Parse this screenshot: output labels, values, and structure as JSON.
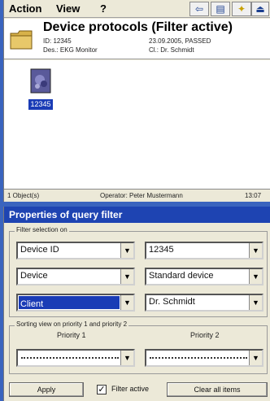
{
  "menubar": {
    "action": "Action",
    "view": "View",
    "help": "?"
  },
  "toolbar": {
    "back_icon": "back-arrow-icon",
    "print_icon": "printer-icon",
    "tool_icon": "tool-icon",
    "exit_icon": "exit-icon"
  },
  "header": {
    "title": "Device protocols  (Filter active)",
    "id_line": "ID: 12345",
    "des_line": "Des.: EKG Monitor",
    "date_line": "23.09.2005, PASSED",
    "cl_line": "Cl.: Dr. Schmidt"
  },
  "file_item": {
    "label": "12345",
    "icon": "protocol-document-icon"
  },
  "status": {
    "objects": "1 Object(s)",
    "operator": "Operator: Peter Mustermann",
    "time": "13:07"
  },
  "dialog": {
    "title": "Properties of query filter",
    "filter_group_label": "Filter selection on",
    "rows": [
      {
        "field": "Device ID",
        "value": "12345"
      },
      {
        "field": "Device",
        "value": "Standard device"
      },
      {
        "field": "Client",
        "value": "Dr. Schmidt"
      }
    ],
    "sort_group_label": "Sorting view on priority 1 and priority 2",
    "priority1_label": "Priority 1",
    "priority2_label": "Priority 2",
    "apply_label": "Apply",
    "filter_active_label": "Filter active",
    "filter_active_checked": true,
    "clear_label": "Clear all items"
  }
}
